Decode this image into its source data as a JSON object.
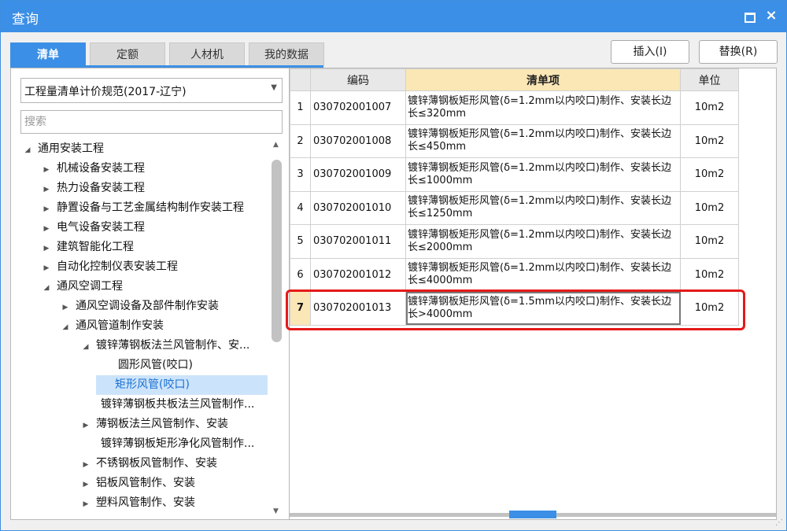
{
  "window": {
    "title": "查询",
    "minimize_label": "",
    "close_label": "×"
  },
  "tabs": [
    {
      "label": "清单",
      "active": true
    },
    {
      "label": "定额",
      "active": false
    },
    {
      "label": "人材机",
      "active": false
    },
    {
      "label": "我的数据",
      "active": false
    }
  ],
  "actions": {
    "insert_label": "插入(I)",
    "replace_label": "替换(R)"
  },
  "left": {
    "spec_select": "工程量清单计价规范(2017-辽宁)",
    "search_placeholder": "搜索",
    "tree": [
      {
        "label": "通用安装工程",
        "arrow": "◢",
        "level": 0
      },
      {
        "label": "机械设备安装工程",
        "arrow": "▶",
        "level": 1
      },
      {
        "label": "热力设备安装工程",
        "arrow": "▶",
        "level": 1
      },
      {
        "label": "静置设备与工艺金属结构制作安装工程",
        "arrow": "▶",
        "level": 1
      },
      {
        "label": "电气设备安装工程",
        "arrow": "▶",
        "level": 1
      },
      {
        "label": "建筑智能化工程",
        "arrow": "▶",
        "level": 1
      },
      {
        "label": "自动化控制仪表安装工程",
        "arrow": "▶",
        "level": 1
      },
      {
        "label": "通风空调工程",
        "arrow": "◢",
        "level": 1
      },
      {
        "label": "通风空调设备及部件制作安装",
        "arrow": "▶",
        "level": 2
      },
      {
        "label": "通风管道制作安装",
        "arrow": "◢",
        "level": 2
      },
      {
        "label": "镀锌薄钢板法兰风管制作、安...",
        "arrow": "◢",
        "level": 3
      },
      {
        "label": "圆形风管(咬口)",
        "arrow": "",
        "level": 4
      },
      {
        "label": "矩形风管(咬口)",
        "arrow": "",
        "level": 4,
        "selected": true
      },
      {
        "label": "镀锌薄钢板共板法兰风管制作...",
        "arrow": "",
        "level": 3
      },
      {
        "label": "薄钢板法兰风管制作、安装",
        "arrow": "▶",
        "level": 3
      },
      {
        "label": "镀锌薄钢板矩形净化风管制作...",
        "arrow": "",
        "level": 3
      },
      {
        "label": "不锈钢板风管制作、安装",
        "arrow": "▶",
        "level": 3
      },
      {
        "label": "铝板风管制作、安装",
        "arrow": "▶",
        "level": 3
      },
      {
        "label": "塑料风管制作、安装",
        "arrow": "▶",
        "level": 3
      }
    ]
  },
  "table": {
    "headers": {
      "code": "编码",
      "item": "清单项",
      "unit": "单位"
    },
    "rows": [
      {
        "num": "1",
        "code": "030702001007",
        "desc": "镀锌薄钢板矩形风管(δ=1.2mm以内咬口)制作、安装长边长≤320mm",
        "unit": "10m2"
      },
      {
        "num": "2",
        "code": "030702001008",
        "desc": "镀锌薄钢板矩形风管(δ=1.2mm以内咬口)制作、安装长边长≤450mm",
        "unit": "10m2"
      },
      {
        "num": "3",
        "code": "030702001009",
        "desc": "镀锌薄钢板矩形风管(δ=1.2mm以内咬口)制作、安装长边长≤1000mm",
        "unit": "10m2"
      },
      {
        "num": "4",
        "code": "030702001010",
        "desc": "镀锌薄钢板矩形风管(δ=1.2mm以内咬口)制作、安装长边长≤1250mm",
        "unit": "10m2"
      },
      {
        "num": "5",
        "code": "030702001011",
        "desc": "镀锌薄钢板矩形风管(δ=1.2mm以内咬口)制作、安装长边长≤2000mm",
        "unit": "10m2"
      },
      {
        "num": "6",
        "code": "030702001012",
        "desc": "镀锌薄钢板矩形风管(δ=1.2mm以内咬口)制作、安装长边长≤4000mm",
        "unit": "10m2"
      },
      {
        "num": "7",
        "code": "030702001013",
        "desc": "镀锌薄钢板矩形风管(δ=1.5mm以内咬口)制作、安装长边长>4000mm",
        "unit": "10m2",
        "current": true
      }
    ]
  },
  "colors": {
    "accent": "#3b8fe6",
    "header_highlight": "#fbe7b6",
    "selection": "#cce4fb",
    "annotation_red": "#e51919"
  },
  "icons": {
    "minimize": "minimize-icon",
    "close": "close-icon",
    "dropdown": "chevron-down-icon",
    "expand": "triangle-right-icon",
    "collapse": "triangle-down-icon"
  }
}
